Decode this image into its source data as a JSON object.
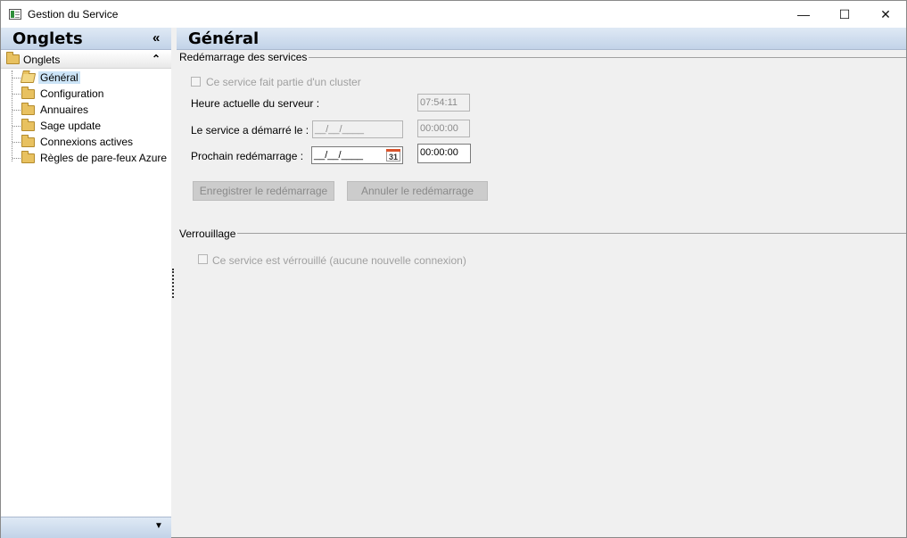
{
  "window": {
    "title": "Gestion du Service",
    "minimize_glyph": "—",
    "maximize_glyph": "☐",
    "close_glyph": "✕"
  },
  "left_pane": {
    "title": "Onglets",
    "collapse_glyph": "«",
    "group": {
      "label": "Onglets",
      "toggle_glyph": "⌃"
    },
    "items": [
      {
        "label": "Général",
        "selected": true
      },
      {
        "label": "Configuration"
      },
      {
        "label": "Annuaires"
      },
      {
        "label": "Sage update"
      },
      {
        "label": "Connexions actives"
      },
      {
        "label": "Règles de pare-feux Azure"
      }
    ],
    "footer_glyph": "▼"
  },
  "content": {
    "title": "Général",
    "restart_section": {
      "label": "Redémarrage des services",
      "cluster_checkbox_label": "Ce service fait partie d'un cluster",
      "server_time_label": "Heure actuelle du serveur :",
      "server_time_value": "07:54:11",
      "started_label": "Le service a démarré le :",
      "started_date_value": "__/__/____",
      "started_time_value": "00:00:00",
      "next_restart_label": "Prochain redémarrage :",
      "next_restart_date_value": "__/__/____",
      "calendar_day": "31",
      "next_restart_time_value": "00:00:00",
      "save_button": "Enregistrer le redémarrage",
      "cancel_button": "Annuler le redémarrage"
    },
    "lock_section": {
      "label": "Verrouillage",
      "lock_checkbox_label": "Ce service est vérrouillé (aucune nouvelle connexion)"
    }
  }
}
